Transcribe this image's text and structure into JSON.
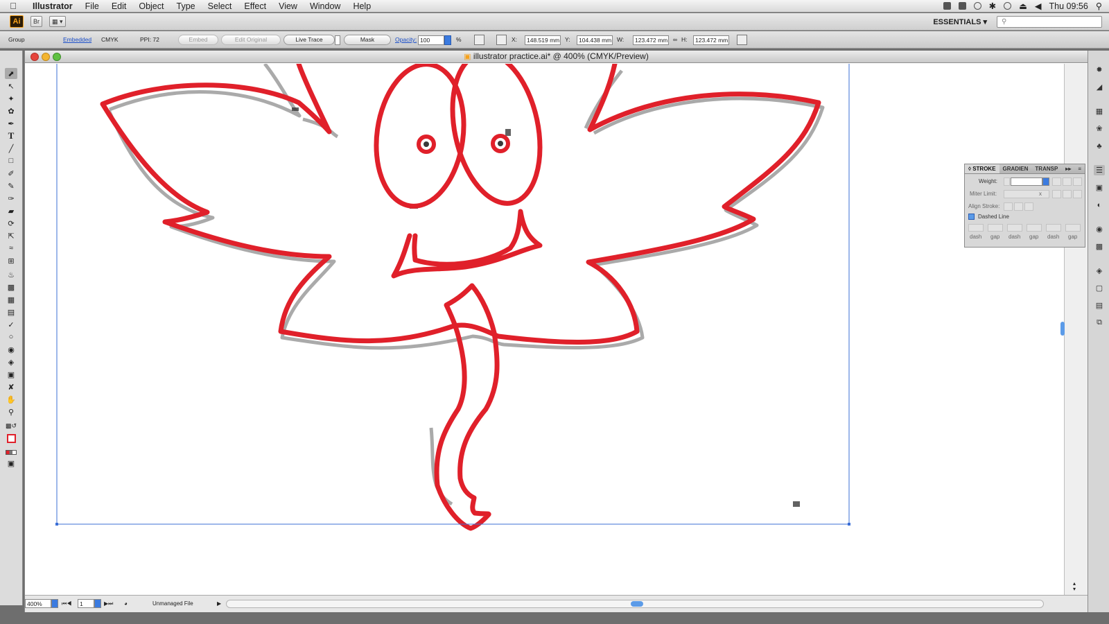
{
  "menubar": {
    "app_name": "Illustrator",
    "items": [
      "File",
      "Edit",
      "Object",
      "Type",
      "Select",
      "Effect",
      "View",
      "Window",
      "Help"
    ],
    "clock": "Thu 09:56"
  },
  "app_bar": {
    "logo": "Ai",
    "bridge_label": "Br",
    "workspace": "ESSENTIALS ▾",
    "search_placeholder": ""
  },
  "control_bar": {
    "selection_type": "Group",
    "link_status": "Embedded",
    "color_mode": "CMYK",
    "ppi": "PPI: 72",
    "embed_label": "Embed",
    "edit_original_label": "Edit Original",
    "live_trace_label": "Live Trace",
    "mask_label": "Mask",
    "opacity_label": "Opacity:",
    "opacity_value": "100",
    "opacity_unit": "%",
    "x_label": "X:",
    "x_value": "148.519 mm",
    "y_label": "Y:",
    "y_value": "104.438 mm",
    "w_label": "W:",
    "w_value": "123.472 mm",
    "h_label": "H:",
    "h_value": "123.472 mm"
  },
  "document": {
    "title": "illustrator practice.ai* @ 400% (CMYK/Preview)",
    "zoom": "400%",
    "artboard_number": "1",
    "status": "Unmanaged File"
  },
  "stroke_panel": {
    "tabs": [
      "STROKE",
      "GRADIEN",
      "TRANSP"
    ],
    "weight_label": "Weight:",
    "weight_value": "",
    "miter_label": "Miter Limit:",
    "miter_suffix": "x",
    "align_label": "Align Stroke:",
    "dashed_label": "Dashed Line",
    "dash_fields": [
      "dash",
      "gap",
      "dash",
      "gap",
      "dash",
      "gap"
    ]
  },
  "colors": {
    "stroke_red": "#e0202a",
    "selection_blue": "#3b6fd6",
    "ai_orange": "#f7a21b"
  },
  "tools": [
    "selection-tool",
    "direct-selection-tool",
    "magic-wand-tool",
    "lasso-tool",
    "pen-tool",
    "type-tool",
    "line-tool",
    "rectangle-tool",
    "paintbrush-tool",
    "pencil-tool",
    "blob-brush-tool",
    "eraser-tool",
    "rotate-tool",
    "scale-tool",
    "warp-tool",
    "free-transform-tool",
    "symbol-sprayer-tool",
    "graph-tool",
    "mesh-tool",
    "gradient-tool",
    "eyedropper-tool",
    "blend-tool",
    "live-paint-bucket-tool",
    "live-paint-selection-tool",
    "artboard-tool",
    "slice-tool",
    "hand-tool",
    "zoom-tool"
  ]
}
